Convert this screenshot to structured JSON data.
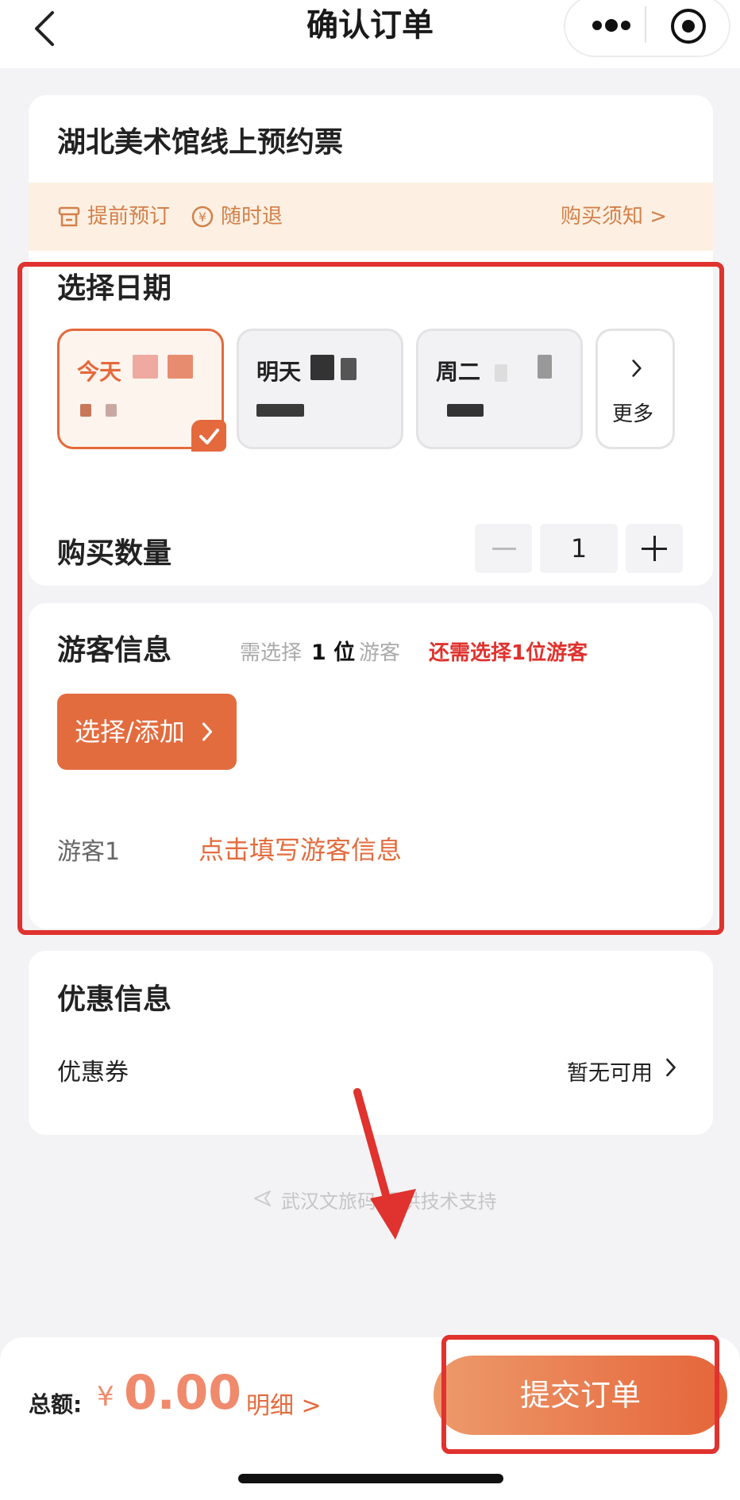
{
  "nav": {
    "title": "确认订单"
  },
  "product": {
    "title": "湖北美术馆线上预约票",
    "tag_advance": "提前预订",
    "tag_refund": "随时退",
    "notice_link": "购买须知 >"
  },
  "date_section": {
    "heading": "选择日期",
    "dates": [
      {
        "label": "今天",
        "selected": true
      },
      {
        "label": "明天",
        "selected": false
      },
      {
        "label": "周二",
        "selected": false
      }
    ],
    "more_label": "更多"
  },
  "quantity": {
    "label": "购买数量",
    "value": "1"
  },
  "visitor": {
    "heading": "游客信息",
    "need_prefix": "需选择",
    "need_count": "1 位",
    "need_suffix": "游客",
    "warning": "还需选择1位游客",
    "add_button": "选择/添加",
    "row_label": "游客1",
    "row_action": "点击填写游客信息"
  },
  "discount": {
    "heading": "优惠信息",
    "coupon_label": "优惠券",
    "coupon_value": "暂无可用"
  },
  "footer": {
    "support_text": "武汉文旅码 提供技术支持"
  },
  "bottom": {
    "total_label": "总额:",
    "currency": "¥",
    "amount": "0.00",
    "detail_link": "明细 >",
    "submit_label": "提交订单"
  },
  "colors": {
    "accent": "#e36c3e",
    "warning": "#e0322e",
    "highlight": "#e0322e"
  }
}
